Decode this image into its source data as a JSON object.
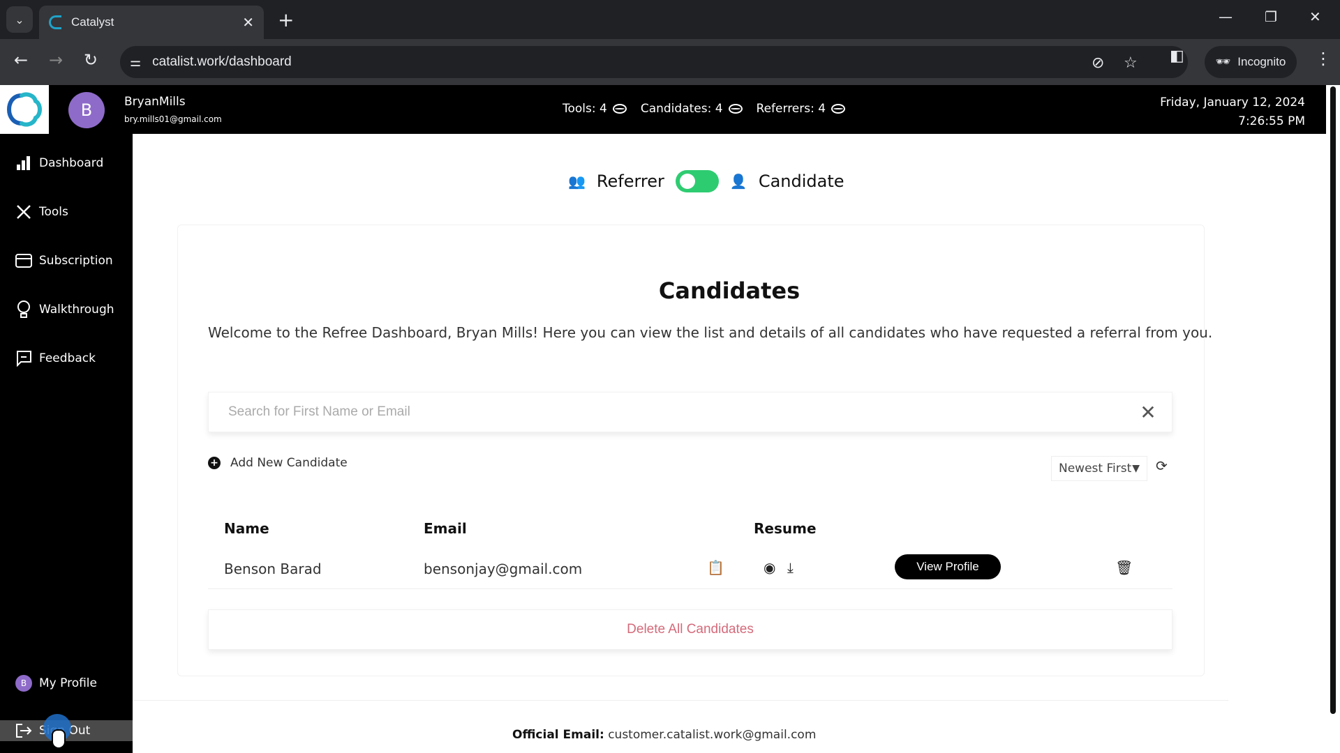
{
  "browser": {
    "tab_title": "Catalyst",
    "url": "catalist.work/dashboard",
    "incognito_label": "Incognito"
  },
  "header": {
    "avatar_initial": "B",
    "user_name": "BryanMills",
    "user_email": "bry.mills01@gmail.com",
    "counters": [
      {
        "label": "Tools: 4"
      },
      {
        "label": "Candidates: 4"
      },
      {
        "label": "Referrers: 4"
      }
    ],
    "date": "Friday, January 12, 2024",
    "time": "7:26:55 PM"
  },
  "sidebar": {
    "items": [
      {
        "label": "Dashboard",
        "icon": "bar-chart-icon"
      },
      {
        "label": "Tools",
        "icon": "tools-icon"
      },
      {
        "label": "Subscription",
        "icon": "credit-card-icon"
      },
      {
        "label": "Walkthrough",
        "icon": "lightbulb-icon"
      },
      {
        "label": "Feedback",
        "icon": "feedback-icon"
      }
    ],
    "profile_label": "My Profile",
    "profile_initial": "B",
    "signout_label": "Sign Out"
  },
  "main": {
    "toggle_left": "Referrer",
    "toggle_right": "Candidate",
    "toggle_state": "on",
    "title": "Candidates",
    "welcome": "Welcome to the Refree Dashboard, Bryan Mills! Here you can view the list and details of all candidates who have requested a referral from you.",
    "search_placeholder": "Search for First Name or Email",
    "search_value": "",
    "add_label": "Add New Candidate",
    "sort_value": "Newest First",
    "table": {
      "headers": [
        "Name",
        "Email",
        "Resume"
      ],
      "rows": [
        {
          "name": "Benson Barad",
          "email": "bensonjay@gmail.com",
          "action": "View Profile"
        }
      ]
    },
    "delete_all_label": "Delete All Candidates",
    "footer_label": "Official Email:",
    "footer_email": "customer.catalist.work@gmail.com"
  },
  "colors": {
    "toggle": "#2ecc71",
    "avatar": "#8e6bc9",
    "delete": "#d46a7a"
  }
}
